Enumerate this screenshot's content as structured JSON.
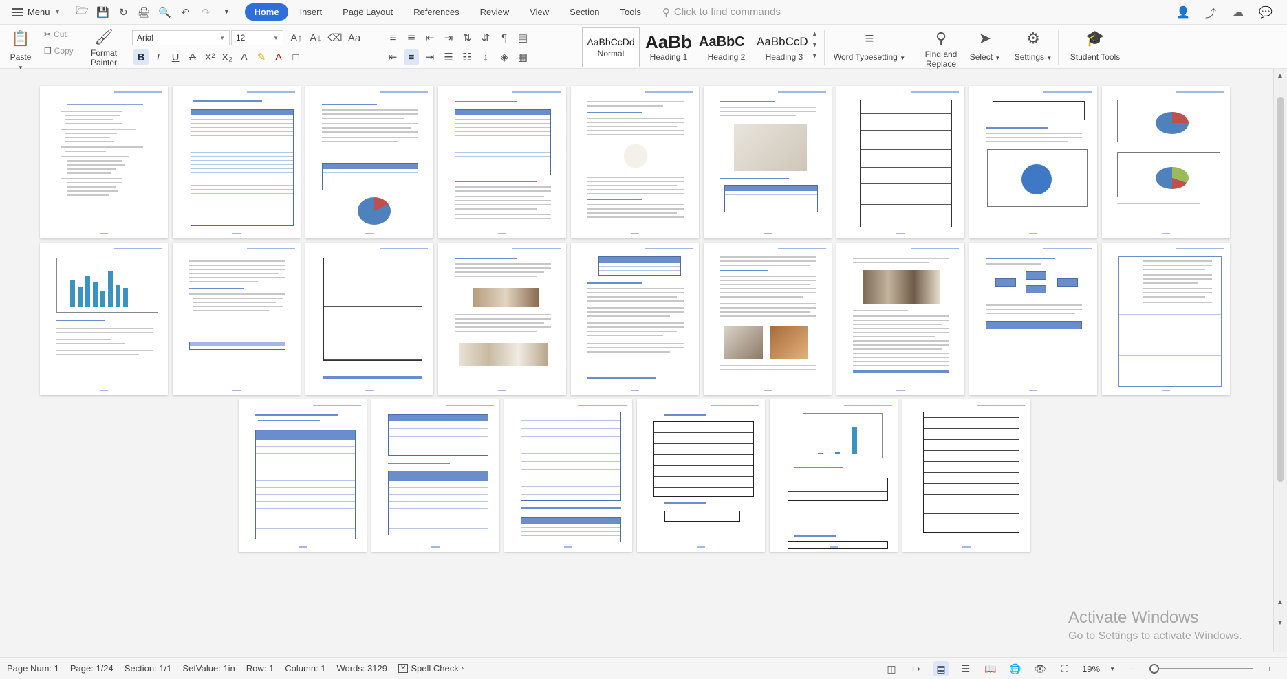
{
  "menubar": {
    "menu_label": "Menu",
    "tabs": [
      {
        "label": "Home",
        "active": true
      },
      {
        "label": "Insert",
        "active": false
      },
      {
        "label": "Page Layout",
        "active": false
      },
      {
        "label": "References",
        "active": false
      },
      {
        "label": "Review",
        "active": false
      },
      {
        "label": "View",
        "active": false
      },
      {
        "label": "Section",
        "active": false
      },
      {
        "label": "Tools",
        "active": false
      }
    ],
    "command_search": "Click to find commands"
  },
  "ribbon": {
    "paste": "Paste",
    "cut": "Cut",
    "copy": "Copy",
    "format_painter_1": "Format",
    "format_painter_2": "Painter",
    "font_name": "Arial",
    "font_size": "12",
    "styles": [
      {
        "sample": "AaBbCcDd",
        "name": "Normal"
      },
      {
        "sample": "AaBb",
        "name": "Heading 1"
      },
      {
        "sample": "AaBbC",
        "name": "Heading 2"
      },
      {
        "sample": "AaBbCcD",
        "name": "Heading 3"
      }
    ],
    "word_typesetting": "Word Typesetting",
    "find_replace_1": "Find and",
    "find_replace_2": "Replace",
    "select": "Select",
    "settings": "Settings",
    "student_tools": "Student Tools"
  },
  "watermark": {
    "line1": "Activate Windows",
    "line2": "Go to Settings to activate Windows."
  },
  "statusbar": {
    "page_num": "Page Num: 1",
    "page": "Page: 1/24",
    "section": "Section: 1/1",
    "setvalue": "SetValue: 1in",
    "row": "Row: 1",
    "column": "Column: 1",
    "words": "Words: 3129",
    "spell_check": "Spell Check",
    "zoom": "19%"
  },
  "accent_color": "#2f6fdc"
}
